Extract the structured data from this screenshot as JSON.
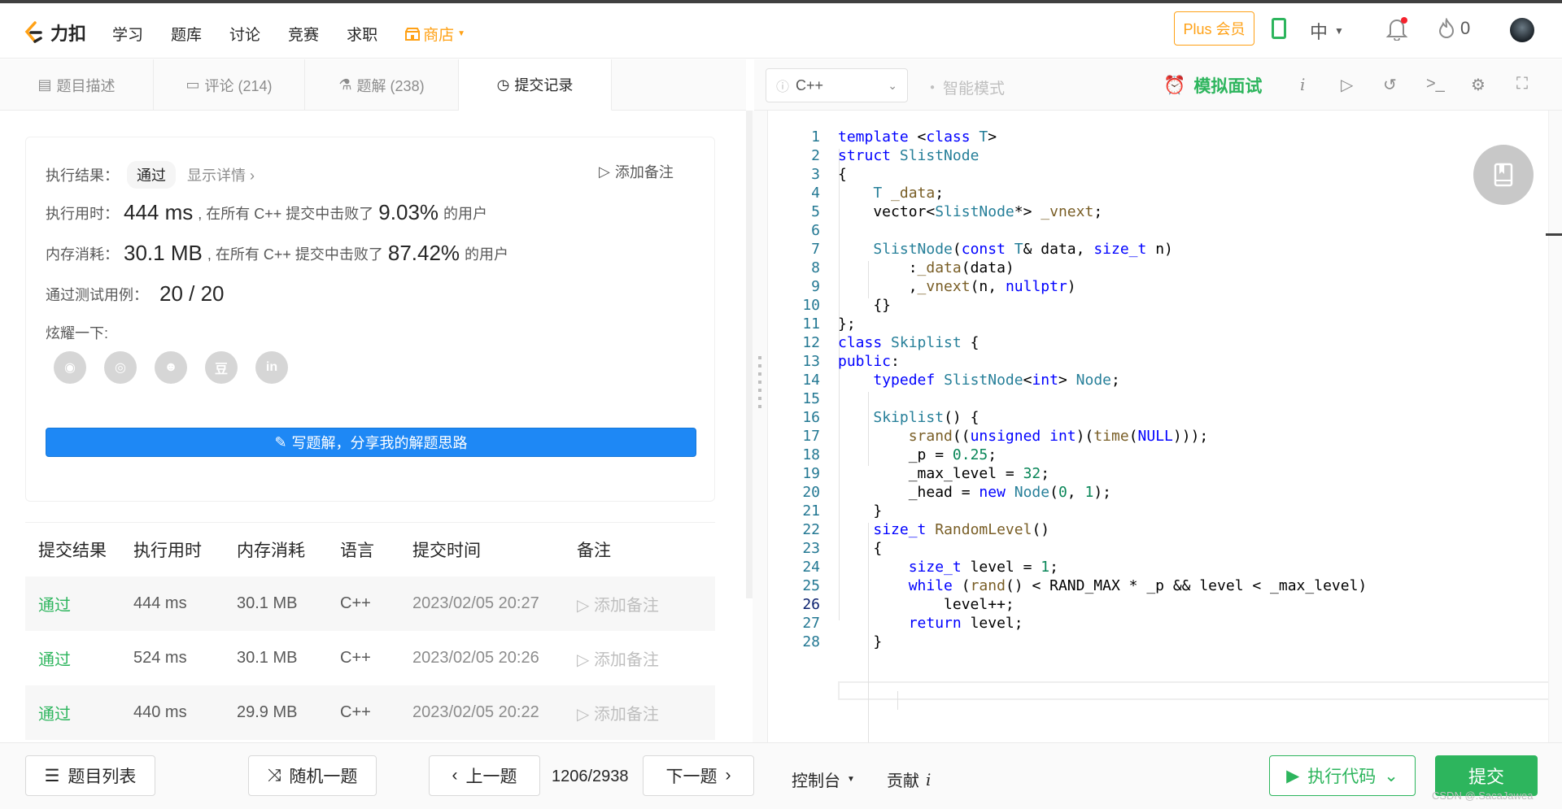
{
  "header": {
    "logo_text": "力扣",
    "nav": [
      "学习",
      "题库",
      "讨论",
      "竞赛",
      "求职"
    ],
    "shop": "商店",
    "plus": "Plus 会员",
    "lang": "中",
    "points": "0"
  },
  "tabs": [
    {
      "label": "题目描述",
      "icon": "doc-icon"
    },
    {
      "label": "评论 (214)",
      "icon": "comment-icon"
    },
    {
      "label": "题解 (238)",
      "icon": "flask-icon"
    },
    {
      "label": "提交记录",
      "icon": "clock-icon"
    }
  ],
  "toolbar": {
    "language": "C++",
    "smart_mode": "智能模式",
    "mock_interview": "模拟面试",
    "info": "i"
  },
  "result": {
    "label_result": "执行结果：",
    "status": "通过",
    "details": "显示详情 ›",
    "add_note": "添加备注",
    "label_time": "执行用时：",
    "time_value": "444 ms",
    "beat_text_prefix": ", 在所有 C++ 提交中击败了",
    "time_percent": "9.03%",
    "users_suffix": "的用户",
    "label_mem": "内存消耗：",
    "mem_value": "30.1 MB",
    "mem_percent": "87.42%",
    "label_cases": "通过测试用例：",
    "cases": "20 / 20",
    "label_share": "炫耀一下:",
    "write_solution": "写题解，分享我的解题思路"
  },
  "table": {
    "headers": [
      "提交结果",
      "执行用时",
      "内存消耗",
      "语言",
      "提交时间",
      "备注"
    ],
    "rows": [
      {
        "status": "通过",
        "time": "444 ms",
        "mem": "30.1 MB",
        "lang": "C++",
        "date": "2023/02/05 20:27",
        "note": "添加备注"
      },
      {
        "status": "通过",
        "time": "524 ms",
        "mem": "30.1 MB",
        "lang": "C++",
        "date": "2023/02/05 20:26",
        "note": "添加备注"
      },
      {
        "status": "通过",
        "time": "440 ms",
        "mem": "29.9 MB",
        "lang": "C++",
        "date": "2023/02/05 20:22",
        "note": "添加备注"
      }
    ]
  },
  "code_lines": [
    "template <class T>",
    "struct SlistNode",
    "{",
    "    T _data;",
    "    vector<SlistNode*> _vnext;",
    "",
    "    SlistNode(const T& data, size_t n)",
    "        :_data(data)",
    "        ,_vnext(n, nullptr)",
    "    {}",
    "};",
    "class Skiplist {",
    "public:",
    "    typedef SlistNode<int> Node;",
    "",
    "    Skiplist() {",
    "        srand((unsigned int)(time(NULL)));",
    "        _p = 0.25;",
    "        _max_level = 32;",
    "        _head = new Node(0, 1);",
    "    }",
    "    size_t RandomLevel()",
    "    {",
    "        size_t level = 1;",
    "        while (rand() < RAND_MAX * _p && level < _max_level)",
    "            level++;",
    "        return level;",
    "    }"
  ],
  "footer": {
    "problem_list": "题目列表",
    "random": "随机一题",
    "prev": "上一题",
    "page": "1206/2938",
    "next": "下一题",
    "console": "控制台",
    "contribute": "贡献",
    "run": "执行代码",
    "submit": "提交",
    "watermark": "CSDN @.SacaJawea"
  }
}
